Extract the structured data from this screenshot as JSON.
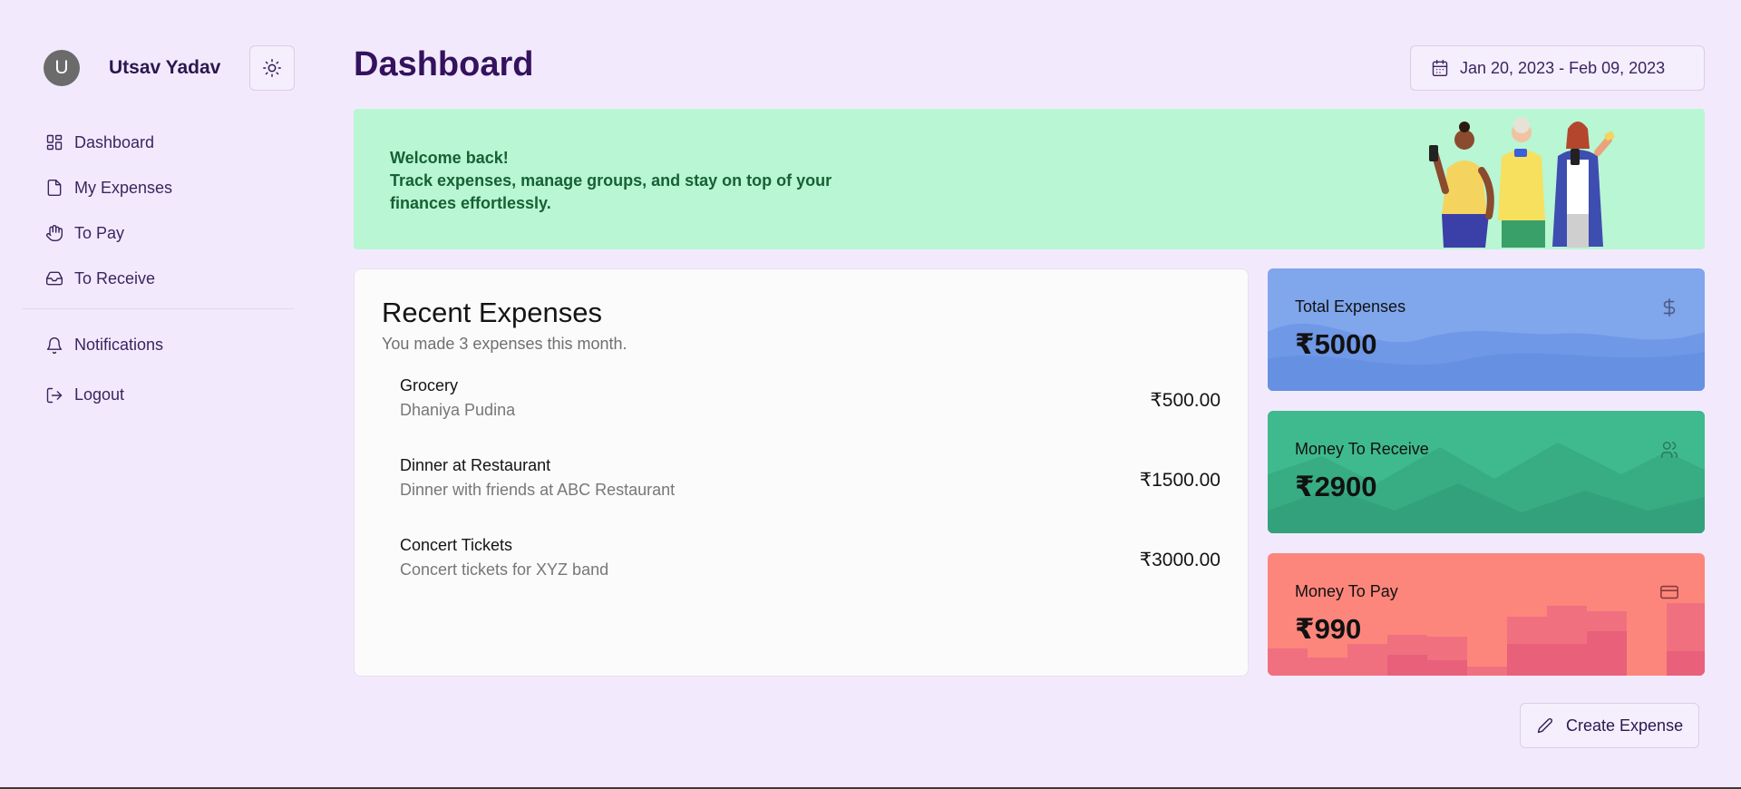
{
  "user": {
    "initial": "U",
    "name": "Utsav Yadav"
  },
  "nav": {
    "primary": [
      {
        "label": "Dashboard",
        "icon": "dashboard-icon"
      },
      {
        "label": "My Expenses",
        "icon": "file-icon"
      },
      {
        "label": "To Pay",
        "icon": "hand-icon"
      },
      {
        "label": "To Receive",
        "icon": "inbox-icon"
      }
    ],
    "secondary": [
      {
        "label": "Notifications",
        "icon": "bell-icon"
      },
      {
        "label": "Logout",
        "icon": "logout-icon"
      }
    ]
  },
  "header": {
    "title": "Dashboard",
    "date_range": "Jan 20, 2023 - Feb 09, 2023"
  },
  "welcome": {
    "line1": "Welcome back!",
    "line2": "Track expenses, manage groups, and stay on top of your finances effortlessly."
  },
  "recent": {
    "title": "Recent Expenses",
    "subtitle": "You made 3 expenses this month.",
    "items": [
      {
        "name": "Grocery",
        "description": "Dhaniya Pudina",
        "amount": "₹500.00"
      },
      {
        "name": "Dinner at Restaurant",
        "description": "Dinner with friends at ABC Restaurant",
        "amount": "₹1500.00"
      },
      {
        "name": "Concert Tickets",
        "description": "Concert tickets for XYZ band",
        "amount": "₹3000.00"
      }
    ]
  },
  "stats": {
    "total": {
      "label": "Total Expenses",
      "value": "₹5000",
      "icon": "dollar-icon",
      "color": "#80a6ec"
    },
    "receive": {
      "label": "Money To Receive",
      "value": "₹2900",
      "icon": "users-icon",
      "color": "#3fba8e"
    },
    "pay": {
      "label": "Money To Pay",
      "value": "₹990",
      "icon": "credit-card-icon",
      "color": "#fc867c"
    }
  },
  "actions": {
    "create_label": "Create Expense"
  },
  "colors": {
    "background": "#f2eafc",
    "banner": "#b9f6d3",
    "banner_text": "#166135",
    "title": "#34125e"
  }
}
